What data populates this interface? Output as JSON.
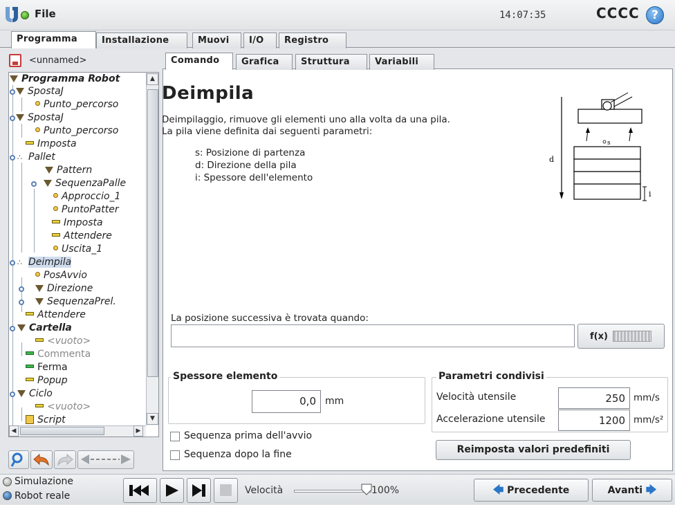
{
  "header": {
    "file_menu": "File",
    "clock": "14:07:35",
    "robot_name": "CCCC",
    "help": "?"
  },
  "main_tabs": [
    "Programma",
    "Installazione",
    "Muovi",
    "I/O",
    "Registro"
  ],
  "program": {
    "file_name": "<unnamed>"
  },
  "tree": {
    "nodes": [
      {
        "label": "Programma Robot"
      },
      {
        "label": "SpostaJ"
      },
      {
        "label": "Punto_percorso"
      },
      {
        "label": "SpostaJ"
      },
      {
        "label": "Punto_percorso"
      },
      {
        "label": "Imposta"
      },
      {
        "label": "Pallet"
      },
      {
        "label": "Pattern"
      },
      {
        "label": "SequenzaPalle"
      },
      {
        "label": "Approccio_1"
      },
      {
        "label": "PuntoPatter"
      },
      {
        "label": "Imposta"
      },
      {
        "label": "Attendere"
      },
      {
        "label": "Uscita_1"
      },
      {
        "label": "Deimpila"
      },
      {
        "label": "PosAvvio"
      },
      {
        "label": "Direzione"
      },
      {
        "label": "SequenzaPrel."
      },
      {
        "label": "Attendere"
      },
      {
        "label": "Cartella"
      },
      {
        "label": "<vuoto>"
      },
      {
        "label": "Commenta"
      },
      {
        "label": "Ferma"
      },
      {
        "label": "Popup"
      },
      {
        "label": "Ciclo"
      },
      {
        "label": "<vuoto>"
      },
      {
        "label": "Script"
      }
    ]
  },
  "sub_tabs": [
    "Comando",
    "Grafica",
    "Struttura",
    "Variabili"
  ],
  "command": {
    "title": "Deimpila",
    "description_1": "Deimpilaggio, rimuove gli elementi uno alla volta da una pila.",
    "description_2": "La pila viene definita dai seguenti parametri:",
    "param_s": "s: Posizione di partenza",
    "param_d": "d: Direzione della pila",
    "param_i": "i: Spessore dell'elemento",
    "diagram": {
      "label_d": "d",
      "label_s": "s",
      "label_i": "i"
    },
    "next_position_label": "La posizione successiva è trovata quando:",
    "next_position_value": "",
    "fx_button": "f(x)"
  },
  "thickness": {
    "title": "Spessore elemento",
    "value": "0,0",
    "unit": "mm"
  },
  "shared_params": {
    "title": "Parametri condivisi",
    "tool_speed_label": "Velocità utensile",
    "tool_speed_value": "250",
    "tool_speed_unit": "mm/s",
    "tool_accel_label": "Accelerazione utensile",
    "tool_accel_value": "1200",
    "tool_accel_unit": "mm/s²",
    "reset_button": "Reimposta valori predefiniti"
  },
  "options": {
    "seq_before_start": "Sequenza prima dell'avvio",
    "seq_after_end": "Sequenza dopo la fine",
    "seq_before_start_checked": false,
    "seq_after_end_checked": false
  },
  "footer": {
    "mode_simulation": "Simulazione",
    "mode_real": "Robot reale",
    "speed_label": "Velocità",
    "speed_value": "100%",
    "speed_fraction": 1.0,
    "prev_button": "Precedente",
    "next_button": "Avanti"
  },
  "colors": {
    "accent_blue": "#2a76c8",
    "status_green": "#3e9a1f",
    "selection": "#cfdcee"
  }
}
